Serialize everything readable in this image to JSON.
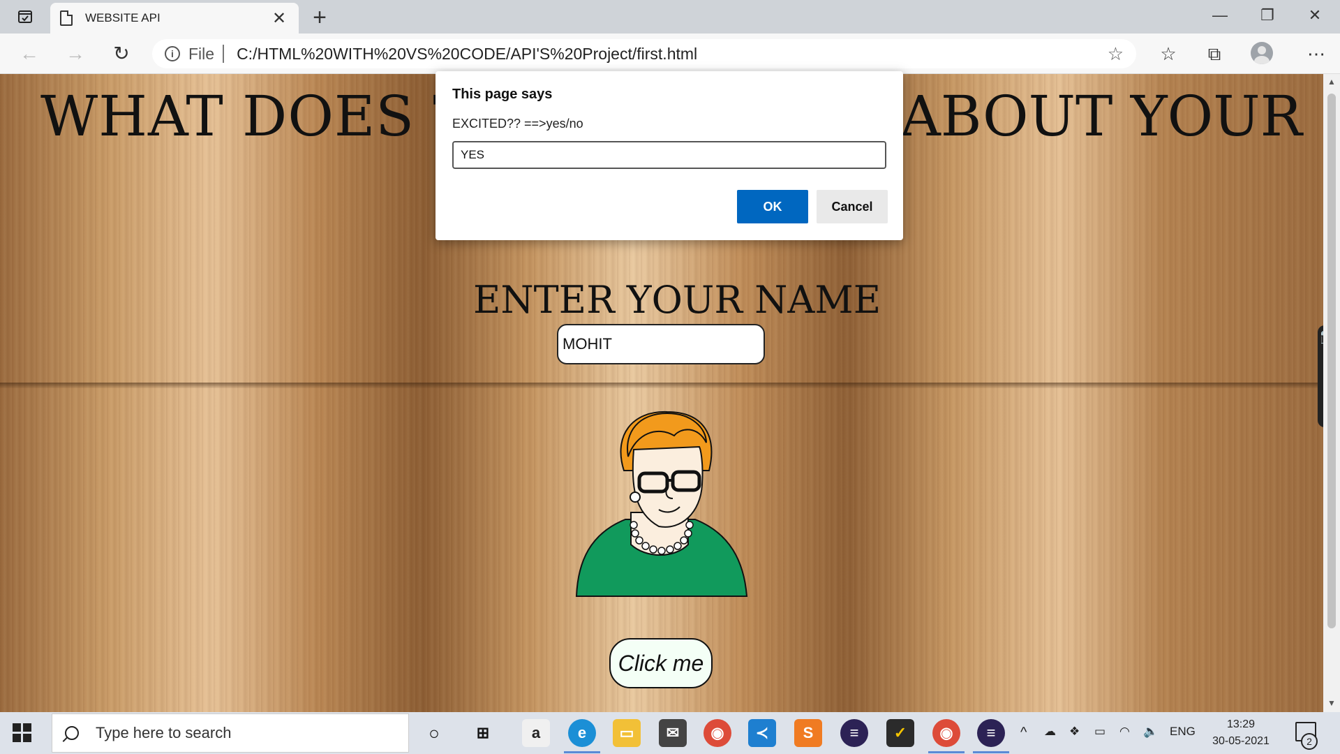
{
  "browser": {
    "tab_title": "WEBSITE API",
    "new_tab": "+",
    "close_tab": "✕",
    "file_label": "File",
    "url": "C:/HTML%20WITH%20VS%20CODE/API'S%20Project/first.html"
  },
  "page": {
    "heading_left": "WHAT DOES T",
    "heading_right": "ABOUT YOUR",
    "enter_name_label": "ENTER YOUR NAME",
    "name_value": "MOHIT",
    "click_button": "Click me"
  },
  "dialog": {
    "title": "This page says",
    "message": "EXCITED?? ==>yes/no",
    "input_value": "YES",
    "ok_label": "OK",
    "cancel_label": "Cancel"
  },
  "taskbar": {
    "search_placeholder": "Type here to search",
    "language": "ENG",
    "time": "13:29",
    "date": "30-05-2021",
    "notification_count": "2"
  },
  "colors": {
    "accent": "#0067c0",
    "character_hair": "#f29a1c",
    "character_shirt": "#119a5c"
  }
}
